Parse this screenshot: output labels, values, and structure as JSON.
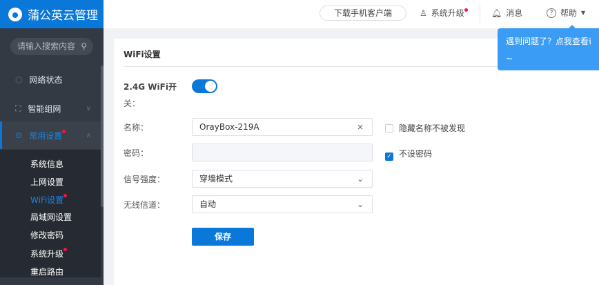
{
  "app": {
    "title": "蒲公英云管理"
  },
  "header": {
    "download": "下载手机客户端",
    "upgrade": "系统升级",
    "messages": "消息",
    "help": "帮助"
  },
  "tooltip": {
    "line1": "遇到问题了？点我查看帮助",
    "line2": "~"
  },
  "sidebar": {
    "search_placeholder": "请输入搜索内容",
    "items": [
      {
        "label": "网络状态"
      },
      {
        "label": "智能组网"
      },
      {
        "label": "常用设置"
      }
    ],
    "sub_items": [
      {
        "label": "系统信息"
      },
      {
        "label": "上网设置"
      },
      {
        "label": "WiFi设置"
      },
      {
        "label": "局域网设置"
      },
      {
        "label": "修改密码"
      },
      {
        "label": "系统升级"
      },
      {
        "label": "重启路由"
      }
    ]
  },
  "form": {
    "title": "WiFi设置",
    "switch_label_1": "2.4G WiFi开",
    "switch_label_2": "关：",
    "switch_on": true,
    "name_label": "名称：",
    "name_value": "OrayBox-219A",
    "hide_label": "隐藏名称不被发现",
    "hide_checked": false,
    "password_label": "密码：",
    "password_value": "",
    "no_password_label": "不设密码",
    "no_password_checked": true,
    "signal_label": "信号强度：",
    "signal_value": "穿墙模式",
    "channel_label": "无线信道：",
    "channel_value": "自动",
    "save": "保存"
  },
  "colors": {
    "brand": "#0a78d8",
    "badge": "#f5134a",
    "tooltip": "#3a9cf5"
  }
}
